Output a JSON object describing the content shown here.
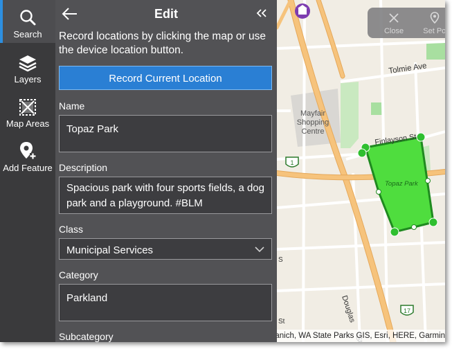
{
  "rail": {
    "items": [
      {
        "label": "Search",
        "icon": "search-icon"
      },
      {
        "label": "Layers",
        "icon": "layers-icon"
      },
      {
        "label": "Map Areas",
        "icon": "map-areas-icon"
      },
      {
        "label": "Add Feature",
        "icon": "add-feature-icon"
      }
    ],
    "active_index": 0
  },
  "panel": {
    "title": "Edit",
    "instructions": "Record locations by clicking the map or use the device location button.",
    "record_button": "Record Current Location",
    "fields": {
      "name": {
        "label": "Name",
        "value": "Topaz Park"
      },
      "description": {
        "label": "Description",
        "value": "Spacious park with four sports fields, a dog park and a playground. #BLM"
      },
      "class": {
        "label": "Class",
        "value": "Municipal Services"
      },
      "category": {
        "label": "Category",
        "value": "Parkland"
      },
      "subcategory": {
        "label": "Subcategory"
      }
    }
  },
  "map": {
    "toolbar": {
      "close_label": "Close",
      "set_point_label": "Set Poi"
    },
    "labels": {
      "street_tolmie": "Tolmie Ave",
      "mall": [
        "Mayfair",
        "Shopping",
        "Centre"
      ],
      "street_finlayson": "Finlayson St",
      "park": "Topaz Park",
      "street_douglas": "Douglas",
      "street_st": "St",
      "route_1": "1",
      "route_17": "17",
      "stub_s": "S",
      "stub_st": "St"
    },
    "attribution": "of Saanich, WA State Parks GIS, Esri, HERE, Garmin",
    "colors": {
      "polygon_fill": "#4fdd3e",
      "polygon_stroke": "#1f8a1f",
      "road": "#f6c37c",
      "accent": "#2a7fd4"
    }
  }
}
